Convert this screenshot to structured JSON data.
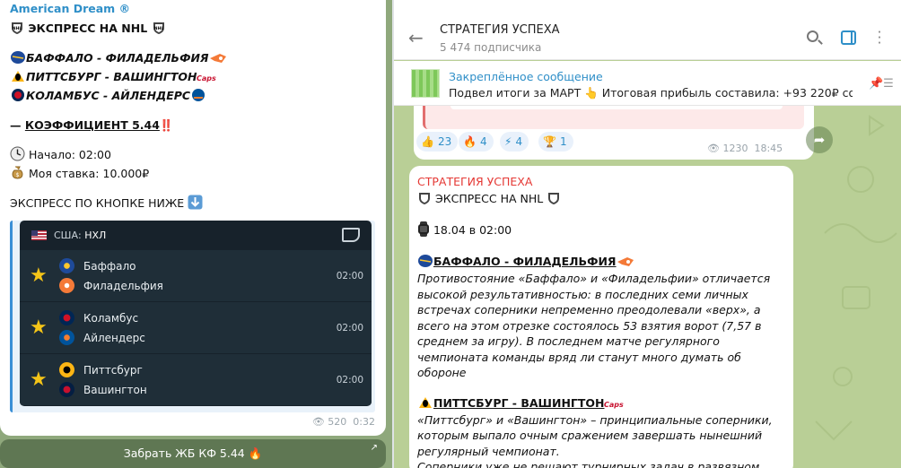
{
  "left": {
    "sender": "American Dream ®",
    "header": "ЭКСПРЕСС НА NHL",
    "matches": [
      "БАФФАЛО - ФИЛАДЕЛЬФИЯ",
      "ПИТТСБУРГ - ВАШИНГТОН",
      "КОЛАМБУС - АЙЛЕНДЕРС"
    ],
    "coef_prefix": "— ",
    "coef": "КОЭФФИЦИЕНТ 5.44",
    "coef_suffix": "‼️",
    "start": "Начало: 02:00",
    "stake": "Моя ставка: 10.000₽",
    "express_button": "ЭКСПРЕСС ПО КНОПКЕ НИЖЕ",
    "card": {
      "league_country": "США:",
      "league": "НХЛ",
      "games": [
        {
          "team1": "Баффало",
          "team2": "Филадельфия",
          "time": "02:00"
        },
        {
          "team1": "Коламбус",
          "team2": "Айлендерс",
          "time": "02:00"
        },
        {
          "team1": "Питтсбург",
          "team2": "Вашингтон",
          "time": "02:00"
        }
      ]
    },
    "views": "520",
    "time": "0:32",
    "button": "Забрать ЖБ КФ 5.44 🔥"
  },
  "right": {
    "channel_title": "СТРАТЕГИЯ УСПЕХА",
    "subscribers": "5 474 подписчика",
    "pinned_label": "Закреплённое сообщение",
    "pinned_text": "Подвел итоги за МАРТ 👆   Итоговая прибыль составила: +93 220₽ со с...",
    "reactions": [
      {
        "emoji": "👍",
        "count": "23"
      },
      {
        "emoji": "🔥",
        "count": "4"
      },
      {
        "emoji": "⚡",
        "count": "4"
      },
      {
        "emoji": "🏆",
        "count": "1"
      }
    ],
    "prev_views": "1230",
    "prev_time": "18:45",
    "msg": {
      "sender": "СТРАТЕГИЯ УСПЕХА",
      "header": "ЭКСПРЕСС НА NHL",
      "date": "18.04 в 02:00",
      "m1_title": "БАФФАЛО - ФИЛАДЕЛЬФИЯ",
      "m1_text": "Противостояние «Баффало» и «Филадельфии» отличается высокой результативностью: в последних семи личных встречах соперники непременно преодолевали «верх», а всего на этом отрезке состоялось 53 взятия ворот (7,57 в среднем за игру). В последнем матче регулярного чемпионата команды вряд ли станут много думать об обороне",
      "m2_title": "ПИТТСБУРГ - ВАШИНГТОН",
      "m2_text": "«Питтсбург» и «Вашингтон» – принципиальные соперники, которым выпало очным сражением завершать нынешний регулярный чемпионат.",
      "m2_text2": "Соперники уже не решают турнирных задач в развязном"
    }
  },
  "colors": {
    "accent": "#2f8fc8",
    "red": "#e53935",
    "star": "#f5c518",
    "card_bg": "#17222b"
  }
}
